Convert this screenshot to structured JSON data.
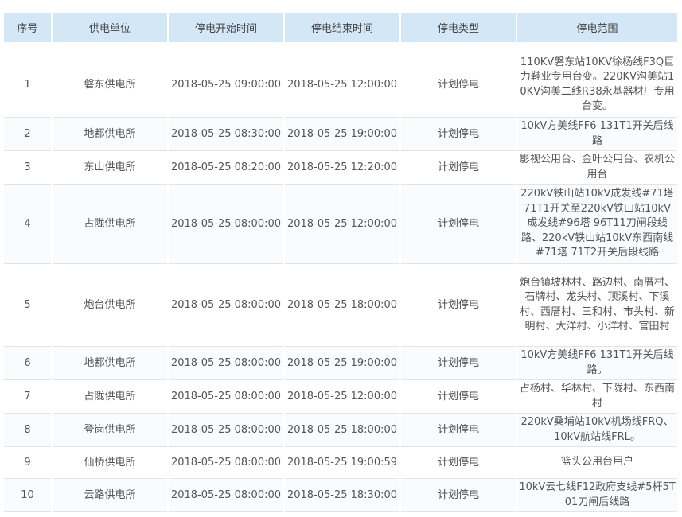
{
  "table": {
    "headers": [
      "序号",
      "供电单位",
      "停电开始时间",
      "停电结束时间",
      "停电类型",
      "停电范围"
    ],
    "rows": [
      {
        "no": "1",
        "unit": "磐东供电所",
        "start": "2018-05-25 09:00:00",
        "end": "2018-05-25 12:00:00",
        "type": "计划停电",
        "scope": "110KV磐东站10KV徐杨线F3Q巨力鞋业专用台变。220KV沟美站10KV沟美二线R38永基器材厂专用台变。"
      },
      {
        "no": "2",
        "unit": "地都供电所",
        "start": "2018-05-25 08:30:00",
        "end": "2018-05-25 19:00:00",
        "type": "计划停电",
        "scope": "10kV方美线FF6 131T1开关后线路"
      },
      {
        "no": "3",
        "unit": "东山供电所",
        "start": "2018-05-25 08:20:00",
        "end": "2018-05-25 12:20:00",
        "type": "计划停电",
        "scope": "影视公用台、金叶公用台、农机公用台"
      },
      {
        "no": "4",
        "unit": "占陇供电所",
        "start": "2018-05-25 08:00:00",
        "end": "2018-05-25 12:00:00",
        "type": "计划停电",
        "scope": "220kV铁山站10kV成发线#71塔71T1开关至220kV铁山站10kV成发线#96塔 96T11刀闸段线路、220kV铁山站10kV东西南线#71塔 71T2开关后段线路"
      },
      {
        "no": "5",
        "unit": "炮台供电所",
        "start": "2018-05-25 08:00:00",
        "end": "2018-05-25 18:00:00",
        "type": "计划停电",
        "scope": "炮台镇坡林村、路边村、南厝村、石牌村、龙头村、顶溪村、下溪村、西厝村、三和村、市头村、新明村、大洋村、小洋村、官田村"
      },
      {
        "no": "6",
        "unit": "地都供电所",
        "start": "2018-05-25 08:00:00",
        "end": "2018-05-25 19:00:00",
        "type": "计划停电",
        "scope": "10kV方美线FF6 131T1开关后线路。"
      },
      {
        "no": "7",
        "unit": "占陇供电所",
        "start": "2018-05-25 08:00:00",
        "end": "2018-05-25 12:00:00",
        "type": "计划停电",
        "scope": "占杨村、华林村、下陇村、东西南村"
      },
      {
        "no": "8",
        "unit": "登岗供电所",
        "start": "2018-05-25 08:00:00",
        "end": "2018-05-25 18:00:00",
        "type": "计划停电",
        "scope": "220kV桑埔站10kV机场线FRQ、10kV航站线FRL。"
      },
      {
        "no": "9",
        "unit": "仙桥供电所",
        "start": "2018-05-25 08:00:00",
        "end": "2018-05-25 19:00:59",
        "type": "计划停电",
        "scope": "篮头公用台用户"
      },
      {
        "no": "10",
        "unit": "云路供电所",
        "start": "2018-05-25 08:00:00",
        "end": "2018-05-25 18:30:00",
        "type": "计划停电",
        "scope": "10kV云七线F12政府支线#5杆5T01刀闸后线路"
      }
    ]
  }
}
